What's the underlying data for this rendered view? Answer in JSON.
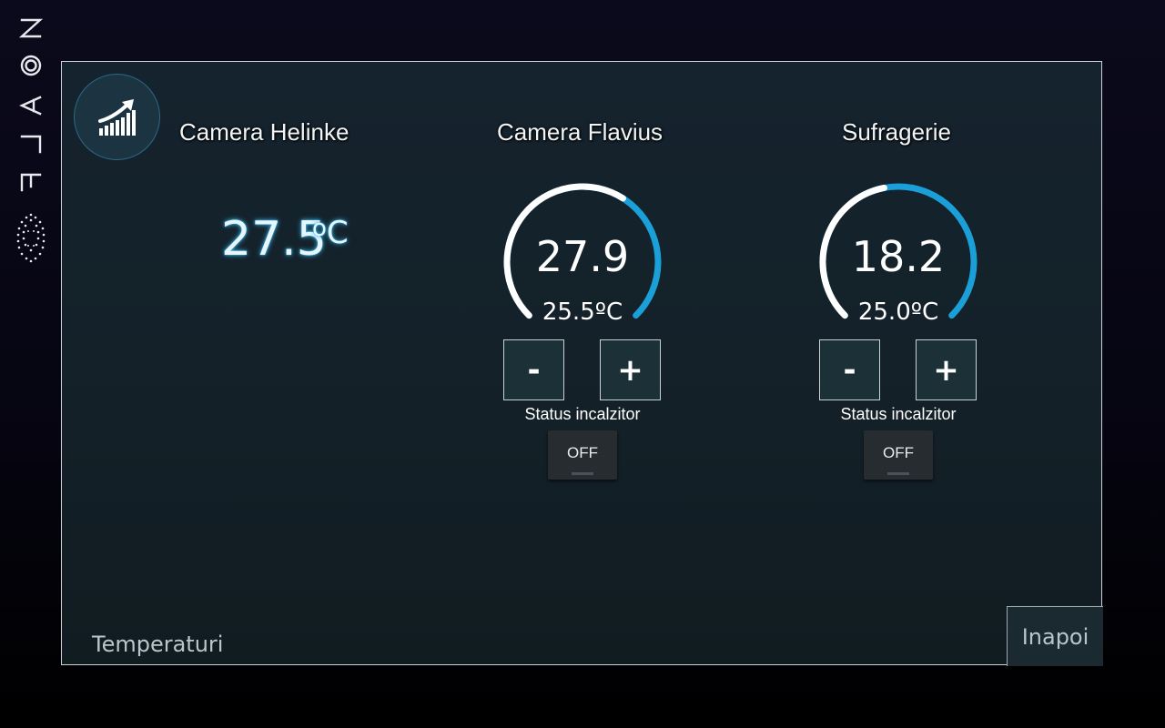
{
  "brand": {
    "name": "FLAON",
    "logo_icon": "dotted-sphere-icon"
  },
  "header": {
    "chart_button_icon": "trending-chart-icon"
  },
  "rooms": [
    {
      "name": "Camera Helinke",
      "current_temp": "27.5",
      "unit": "oC"
    },
    {
      "name": "Camera Flavius",
      "current_temp": "27.9",
      "setpoint": "25.5ºC",
      "gauge_fraction": 0.62,
      "minus_label": "-",
      "plus_label": "+",
      "status_label": "Status incalzitor",
      "heater_state": "OFF"
    },
    {
      "name": "Sufragerie",
      "current_temp": "18.2",
      "setpoint": "25.0ºC",
      "gauge_fraction": 0.46,
      "minus_label": "-",
      "plus_label": "+",
      "status_label": "Status incalzitor",
      "heater_state": "OFF"
    }
  ],
  "footer": {
    "title": "Temperaturi",
    "back_label": "Inapoi"
  },
  "colors": {
    "gauge_active": "#ffffff",
    "gauge_track": "#1b9fd8",
    "panel_border": "#c9d3d8",
    "glow": "#38b4e6"
  }
}
